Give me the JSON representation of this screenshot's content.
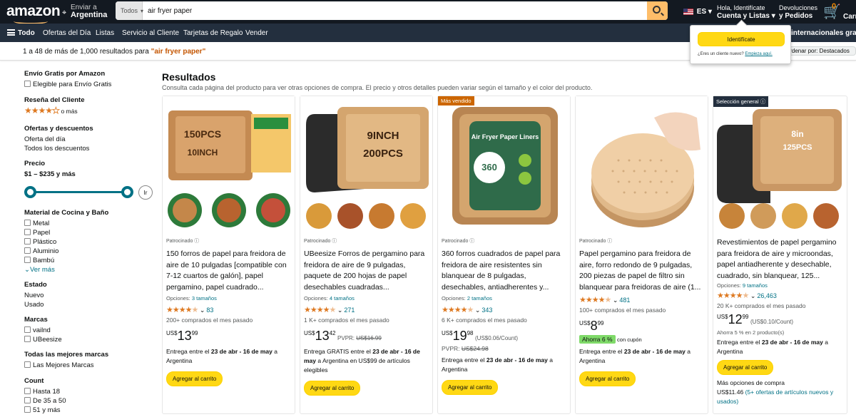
{
  "header": {
    "logo": "amazon",
    "deliver_line1": "Enviar a",
    "deliver_line2": "Argentina",
    "search_category": "Todos",
    "search_query": "air fryer paper",
    "language": "ES",
    "account_line1": "Hola, Identifícate",
    "account_line2": "Cuenta y Listas ▾",
    "orders_line1": "Devoluciones",
    "orders_line2": "y Pedidos",
    "cart_count": "0",
    "cart_label": "Carrito"
  },
  "nav": {
    "all": "Todo",
    "items": [
      "Ofertas del Día",
      "Listas",
      "Servicio al Cliente",
      "Tarjetas de Regalo",
      "Vender"
    ],
    "right_extra": "internacionales grat"
  },
  "signin_popover": {
    "button": "Identifícate",
    "new_customer": "¿Eres un cliente nuevo?",
    "start_link": "Empieza aquí."
  },
  "results_bar": {
    "prefix": "1 a 48 de más de 1,000 resultados para ",
    "query": "\"air fryer paper\"",
    "sort_label": "Ordenar por:",
    "sort_value": "Destacados"
  },
  "sidebar": {
    "free_shipping_h": "Envío Gratis por Amazon",
    "free_shipping_opt": "Elegible para Envío Gratis",
    "review_h": "Reseña del Cliente",
    "review_more": "o más",
    "deals_h": "Ofertas y descuentos",
    "deals_items": [
      "Oferta del día",
      "Todos los descuentos"
    ],
    "price_h": "Precio",
    "price_range": "$1 – $235 y más",
    "price_go": "Ir",
    "material_h": "Material de Cocina y Baño",
    "material_items": [
      "Metal",
      "Papel",
      "Plástico",
      "Aluminio",
      "Bambú"
    ],
    "see_more": "Ver más",
    "condition_h": "Estado",
    "condition_items": [
      "Nuevo",
      "Usado"
    ],
    "brands_h": "Marcas",
    "brands_items": [
      "vailnd",
      "UBeesize"
    ],
    "top_brands_h": "Todas las mejores marcas",
    "top_brands_item": "Las Mejores Marcas",
    "count_h": "Count",
    "count_items": [
      "Hasta 18",
      "De 35 a 50",
      "51 y más"
    ]
  },
  "main": {
    "heading": "Resultados",
    "subheading": "Consulta cada página del producto para ver otras opciones de compra. El precio y otros detalles pueden variar según el tamaño y el color del producto."
  },
  "products": [
    {
      "badge": "",
      "img_text1": "150PCS",
      "img_text2": "10INCH",
      "sponsored": "Patrocinado",
      "title": "150 forros de papel para freidora de aire de 10 pulgadas [compatible con 7-12 cuartos de galón], papel pergamino, papel cuadrado...",
      "options_label": "Opciones: ",
      "options_link": "3 tamaños",
      "rating": 4.5,
      "reviews": "83",
      "bought": "200+ comprados el mes pasado",
      "currency": "US$",
      "price_whole": "13",
      "price_frac": "99",
      "price_extra": "",
      "list_price": "",
      "delivery_pre": "Entrega entre el ",
      "delivery_dates": "23 de abr - 16 de may",
      "delivery_post": " a Argentina",
      "add_to_cart": "Agregar al carrito"
    },
    {
      "badge": "",
      "img_text1": "9INCH",
      "img_text2": "200PCS",
      "sponsored": "Patrocinado",
      "title": "UBeesize Forros de pergamino para freidora de aire de 9 pulgadas, paquete de 200 hojas de papel desechables cuadradas...",
      "options_label": "Opciones: ",
      "options_link": "4 tamaños",
      "rating": 4.5,
      "reviews": "271",
      "bought": "1 K+ comprados el mes pasado",
      "currency": "US$",
      "price_whole": "13",
      "price_frac": "42",
      "price_extra": "PVPR: ",
      "list_price": "US$16.99",
      "delivery_pre": "Entrega GRATIS entre el ",
      "delivery_dates": "23 de abr - 16 de may",
      "delivery_post": " a Argentina en US$99 de artículos elegibles",
      "add_to_cart": "Agregar al carrito"
    },
    {
      "badge": "Más vendido",
      "img_text1": "360",
      "img_text2": "Air Fryer Paper Liners",
      "sponsored": "Patrocinado",
      "title": "360 forros cuadrados de papel para freidora de aire resistentes sin blanquear de 8 pulgadas, desechables, antiadherentes y...",
      "options_label": "Opciones: ",
      "options_link": "2 tamaños",
      "rating": 4.5,
      "reviews": "343",
      "bought": "6 K+ comprados el mes pasado",
      "currency": "US$",
      "price_whole": "19",
      "price_frac": "98",
      "price_extra": "(US$0.06/Count)",
      "list_price_label": "PVPR: ",
      "list_price": "US$24.98",
      "delivery_pre": "Entrega entre el ",
      "delivery_dates": "23 de abr - 16 de may",
      "delivery_post": " a Argentina",
      "add_to_cart": "Agregar al carrito"
    },
    {
      "badge": "",
      "img_text1": "",
      "img_text2": "",
      "sponsored": "Patrocinado",
      "title": "Papel pergamino para freidora de aire, forro redondo de 9 pulgadas, 200 piezas de papel de filtro sin blanquear para freidoras de aire (1...",
      "options_label": "",
      "options_link": "",
      "rating": 4.5,
      "reviews": "481",
      "bought": "100+ comprados el mes pasado",
      "currency": "US$",
      "price_whole": "8",
      "price_frac": "99",
      "price_extra": "",
      "list_price": "",
      "coupon_badge": "Ahorra 6 %",
      "coupon_text": "con cupón",
      "delivery_pre": "Entrega entre el ",
      "delivery_dates": "23 de abr - 16 de may",
      "delivery_post": " a Argentina",
      "add_to_cart": "Agregar al carrito"
    },
    {
      "badge": "Selección general",
      "img_text1": "8in",
      "img_text2": "125PCS",
      "sponsored": "",
      "title": "Revestimientos de papel pergamino para freidora de aire y microondas, papel antiadherente y desechable, cuadrado, sin blanquear, 125...",
      "options_label": "Opciones: ",
      "options_link": "9 tamaños",
      "rating": 4.5,
      "reviews": "26,463",
      "bought": "20 K+ comprados el mes pasado",
      "currency": "US$",
      "price_whole": "12",
      "price_frac": "99",
      "price_extra": "(US$0.10/Count)",
      "list_price": "",
      "promo": "Ahorra 5 % en 2 producto(s)",
      "delivery_pre": "Entrega entre el ",
      "delivery_dates": "23 de abr - 16 de may",
      "delivery_post": " a Argentina",
      "add_to_cart": "Agregar al carrito",
      "more_options": "Más opciones de compra",
      "more_price": "US$11.46",
      "more_link": "(5+ ofertas de artículos nuevos y usados)"
    }
  ],
  "colors": {
    "header_bg": "#131921",
    "nav_bg": "#232f3e",
    "search_btn": "#febd69",
    "cart_btn": "#ffd814",
    "link": "#007185",
    "star": "#de7921"
  }
}
